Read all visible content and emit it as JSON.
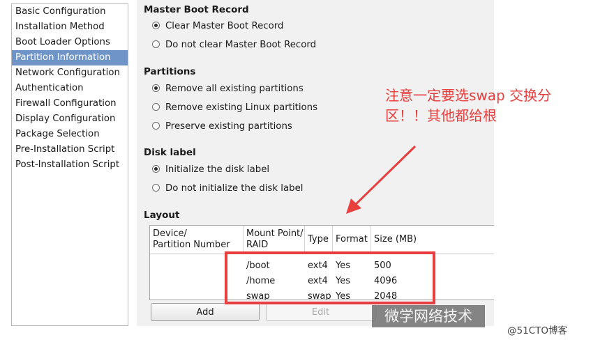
{
  "sidebar": {
    "items": [
      {
        "label": "Basic Configuration"
      },
      {
        "label": "Installation Method"
      },
      {
        "label": "Boot Loader Options"
      },
      {
        "label": "Partition Information",
        "selected": true
      },
      {
        "label": "Network Configuration"
      },
      {
        "label": "Authentication"
      },
      {
        "label": "Firewall Configuration"
      },
      {
        "label": "Display Configuration"
      },
      {
        "label": "Package Selection"
      },
      {
        "label": "Pre-Installation Script"
      },
      {
        "label": "Post-Installation Script"
      }
    ]
  },
  "mbr": {
    "title": "Master Boot Record",
    "options": [
      {
        "label": "Clear Master Boot Record",
        "checked": true
      },
      {
        "label": "Do not clear Master Boot Record",
        "checked": false
      }
    ]
  },
  "partitions": {
    "title": "Partitions",
    "options": [
      {
        "label": "Remove all existing partitions",
        "checked": true
      },
      {
        "label": "Remove existing Linux partitions",
        "checked": false
      },
      {
        "label": "Preserve existing partitions",
        "checked": false
      }
    ]
  },
  "disk_label": {
    "title": "Disk label",
    "options": [
      {
        "label": "Initialize the disk label",
        "checked": true
      },
      {
        "label": "Do not initialize the disk label",
        "checked": false
      }
    ]
  },
  "layout": {
    "title": "Layout",
    "columns": {
      "device_line1": "Device/",
      "device_line2": "Partition Number",
      "mount_line1": "Mount Point/",
      "mount_line2": "RAID",
      "type": "Type",
      "format": "Format",
      "size": "Size (MB)"
    },
    "rows": [
      {
        "device": "",
        "mount": "/boot",
        "type": "ext4",
        "format": "Yes",
        "size": "500"
      },
      {
        "device": "",
        "mount": "/home",
        "type": "ext4",
        "format": "Yes",
        "size": "4096"
      },
      {
        "device": "",
        "mount": "swap",
        "type": "swap",
        "format": "Yes",
        "size": "2048"
      }
    ]
  },
  "buttons": {
    "add": "Add",
    "edit": "Edit"
  },
  "annotation": {
    "text": "注意一定要选swap 交换分区！！其他都给根",
    "color": "#e83e3e"
  },
  "watermark": "微学网络技术",
  "credit": "@51CTO博客",
  "colors": {
    "selection": "#6f94c8",
    "panel_bg": "#f1f1f1",
    "annotation_red": "#e83e3e"
  }
}
